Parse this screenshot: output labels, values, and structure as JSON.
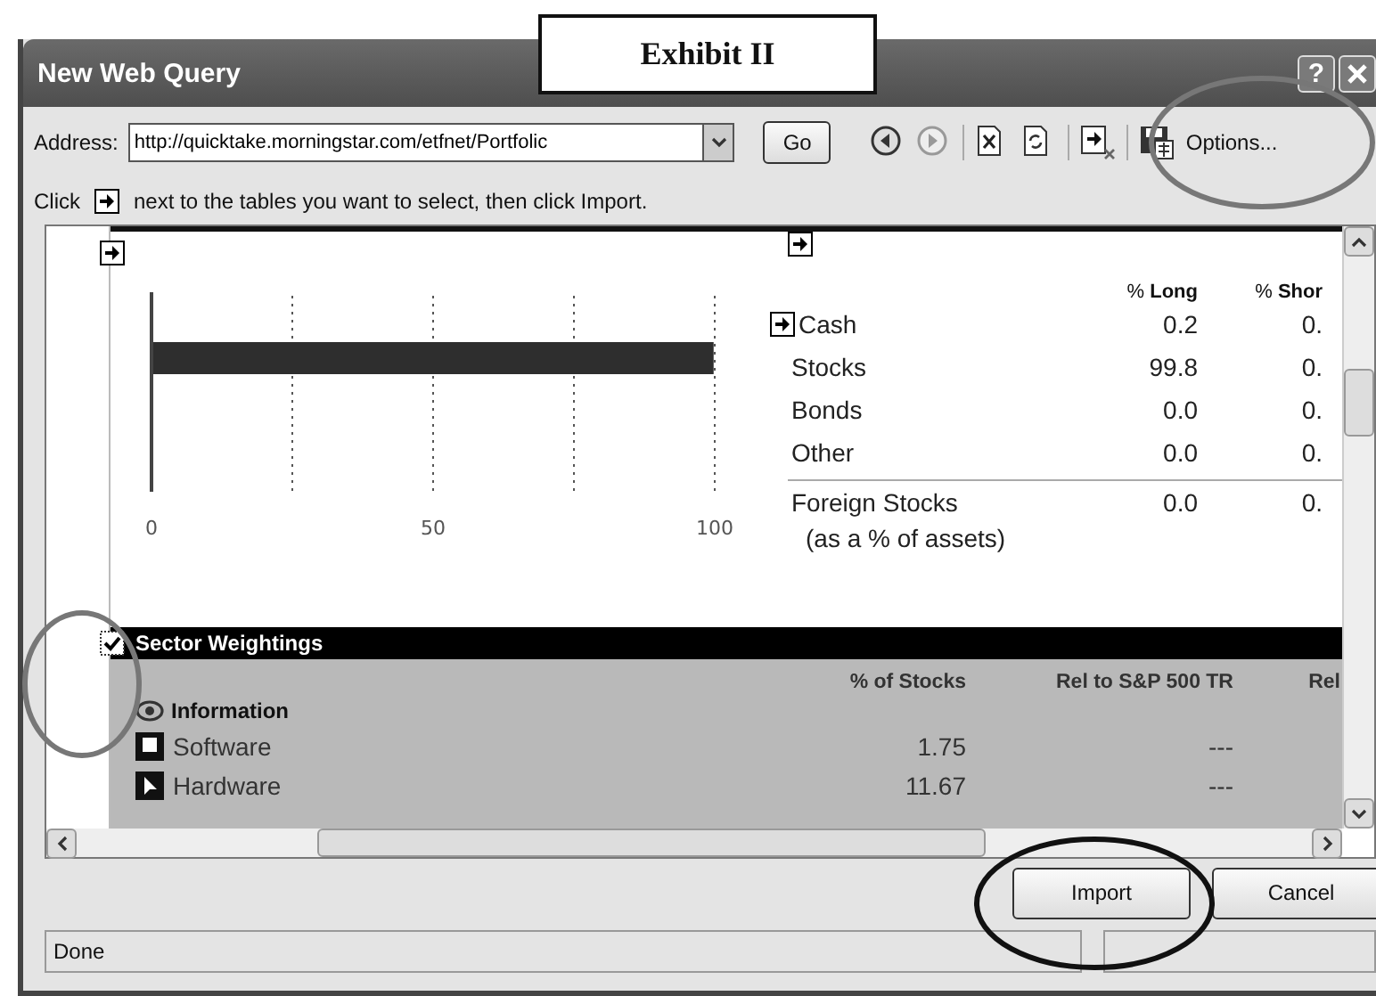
{
  "exhibit_label": "Exhibit II",
  "window": {
    "title": "New Web Query",
    "help": "?"
  },
  "toolbar": {
    "address_label": "Address:",
    "address": "http://quicktake.morningstar.com/etfnet/Portfolic",
    "go": "Go",
    "options": "Options..."
  },
  "hint": {
    "click": "Click",
    "text": "next to the tables you want to select, then click Import."
  },
  "tables": [
    {
      "kind": "chart",
      "selected": false,
      "chart_data": {
        "type": "bar",
        "orientation": "horizontal",
        "values": [
          99.8
        ],
        "xlim": [
          0,
          100
        ],
        "xticks": [
          0,
          50,
          100
        ]
      }
    },
    {
      "kind": "assets",
      "selected": false,
      "inner_selected": false,
      "columns": [
        "% **Long**",
        "% **Shor**"
      ],
      "rows": [
        {
          "label": "Cash",
          "values": [
            "0.2",
            "0."
          ]
        },
        {
          "label": "Stocks",
          "values": [
            "99.8",
            "0."
          ]
        },
        {
          "label": "Bonds",
          "values": [
            "0.0",
            "0."
          ]
        },
        {
          "label": "Other",
          "values": [
            "0.0",
            "0."
          ]
        },
        {
          "label": "Foreign Stocks",
          "note": "(as a % of assets)",
          "values": [
            "0.0",
            "0."
          ]
        }
      ]
    },
    {
      "kind": "sector",
      "selected": true,
      "title": "Sector Weightings",
      "columns": [
        "% of Stocks",
        "Rel to S&P 500 TR",
        "Rel"
      ],
      "rows": [
        {
          "kind": "group",
          "label": "Information"
        },
        {
          "kind": "row",
          "label": "Software",
          "values": [
            "1.75",
            "---"
          ]
        },
        {
          "kind": "row",
          "label": "Hardware",
          "values": [
            "11.67",
            "---"
          ]
        }
      ]
    }
  ],
  "buttons": [
    {
      "label": "Import"
    },
    {
      "label": "Cancel"
    }
  ],
  "status_bar": {
    "text": "Done"
  }
}
